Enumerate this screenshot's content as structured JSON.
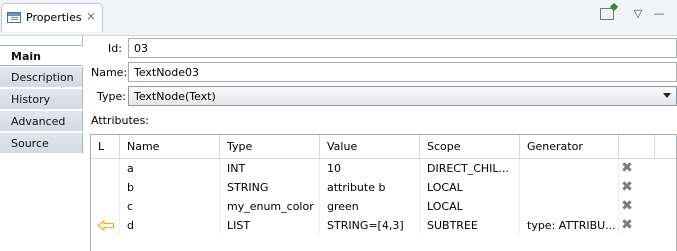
{
  "view": {
    "tab_title": "Properties",
    "tab_close": "⨯",
    "toolbar": {
      "pin_icon": "pin-view-icon",
      "menu_icon": "▽",
      "minimize_icon": "—"
    }
  },
  "side_tabs": [
    {
      "label": "Main",
      "active": true
    },
    {
      "label": "Description",
      "active": false
    },
    {
      "label": "History",
      "active": false
    },
    {
      "label": "Advanced",
      "active": false
    },
    {
      "label": "Source",
      "active": false
    }
  ],
  "form": {
    "id_label": "Id:",
    "id_value": "03",
    "name_label": "Name:",
    "name_value": "TextNode03",
    "type_label": "Type:",
    "type_value": "TextNode(Text)",
    "attributes_label": "Attributes:"
  },
  "table": {
    "headers": [
      "L",
      "Name",
      "Type",
      "Value",
      "Scope",
      "Generator"
    ],
    "rows": [
      {
        "l": "",
        "name": "a",
        "type": "INT",
        "value": "10",
        "scope": "DIRECT_CHIL...",
        "generator": "",
        "inherited": false
      },
      {
        "l": "",
        "name": "b",
        "type": "STRING",
        "value": "attribute b",
        "scope": "LOCAL",
        "generator": "",
        "inherited": false
      },
      {
        "l": "",
        "name": "c",
        "type": "my_enum_color",
        "value": "green",
        "scope": "LOCAL",
        "generator": "",
        "inherited": false
      },
      {
        "l": "",
        "name": "d",
        "type": "LIST",
        "value": "STRING=[4,3]",
        "scope": "SUBTREE",
        "generator": "type: ATTRIBU...",
        "inherited": true
      }
    ],
    "delete_icon": "✖"
  },
  "colors": {
    "header_bg": "#f1f3f7",
    "side_tab_bg": "#dde3eb",
    "inherit_arrow": "#e8a91b"
  }
}
